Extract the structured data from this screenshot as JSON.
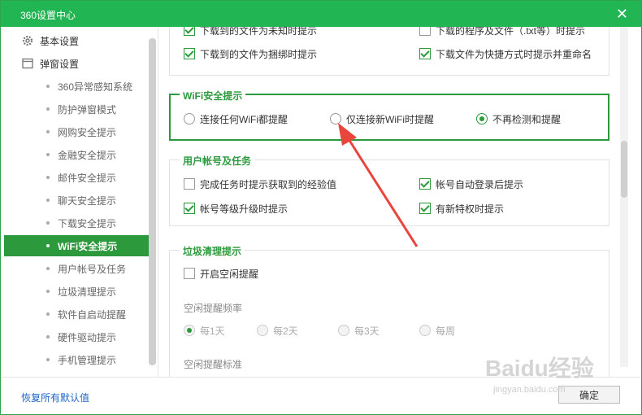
{
  "window": {
    "title": "360设置中心",
    "close_glyph": "✕"
  },
  "sidebar": {
    "sections": [
      {
        "label": "基本设置",
        "icon": "gear-icon"
      },
      {
        "label": "弹窗设置",
        "icon": "window-icon"
      }
    ],
    "items": [
      {
        "label": "360异常感知系统",
        "active": false
      },
      {
        "label": "防护弹窗模式",
        "active": false
      },
      {
        "label": "网购安全提示",
        "active": false
      },
      {
        "label": "金融安全提示",
        "active": false
      },
      {
        "label": "邮件安全提示",
        "active": false
      },
      {
        "label": "聊天安全提示",
        "active": false
      },
      {
        "label": "下载安全提示",
        "active": false
      },
      {
        "label": "WiFi安全提示",
        "active": true
      },
      {
        "label": "用户帐号及任务",
        "active": false
      },
      {
        "label": "垃圾清理提示",
        "active": false
      },
      {
        "label": "软件自启动提醒",
        "active": false
      },
      {
        "label": "硬件驱动提示",
        "active": false
      },
      {
        "label": "手机管理提示",
        "active": false
      }
    ]
  },
  "download": {
    "cut_left": "下载到的文件为未知时提示",
    "cut_right": "下载的程序及文件（.txt等）时提示",
    "left": "下载到的文件为捆绑时提示",
    "right": "下载文件为快捷方式时提示并重命名"
  },
  "wifi": {
    "title": "WiFi安全提示",
    "options": [
      {
        "label": "连接任何WiFi都提醒",
        "checked": false
      },
      {
        "label": "仅连接新WiFi时提醒",
        "checked": false
      },
      {
        "label": "不再检测和提醒",
        "checked": true
      }
    ]
  },
  "account": {
    "title": "用户帐号及任务",
    "opt1": "完成任务时提示获取到的经验值",
    "opt2": "帐号自动登录后提示",
    "opt3": "帐号等级升级时提示",
    "opt4": "有新特权时提示"
  },
  "junk": {
    "title": "垃圾清理提示",
    "idle_label": "开启空闲提醒",
    "freq_label": "空闲提醒频率",
    "freq_options": [
      "每1天",
      "每2天",
      "每3天",
      "每周"
    ],
    "standard_label": "空闲提醒标准"
  },
  "footer": {
    "restore": "恢复所有默认值",
    "ok": "确定"
  },
  "watermark": {
    "brand": "Baidu经验",
    "url": "jingyan.baidu.com"
  },
  "colors": {
    "accent": "#21b553",
    "arrow": "#e8453c"
  }
}
